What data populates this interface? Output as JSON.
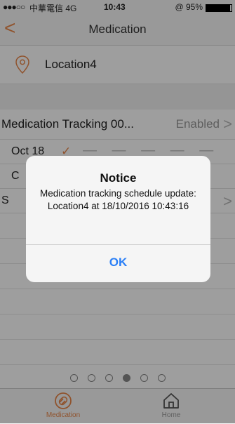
{
  "status_bar": {
    "signal": "●●●○○",
    "carrier": "中華電信 4G",
    "time": "10:43",
    "battery": "@ 95%",
    "battery_level": 0.95
  },
  "nav": {
    "back": "<",
    "title": "Medication"
  },
  "location": {
    "name": "Location4"
  },
  "tracking": {
    "label": "Medication Tracking 00...",
    "status": "Enabled",
    "chevron": ">"
  },
  "schedule": {
    "date": "Oct  18",
    "check": "✓",
    "dashes": "— — — — — —"
  },
  "rows": {
    "row_b_label": "C",
    "row_c_label": "S",
    "row_c_chevron": ">"
  },
  "pager": {
    "count": 6,
    "active_index": 3
  },
  "tabbar": {
    "items": [
      {
        "label": "Medication",
        "icon": "pill-icon",
        "active": true
      },
      {
        "label": "Home",
        "icon": "home-icon",
        "active": false
      }
    ]
  },
  "alert": {
    "title": "Notice",
    "message": "Medication tracking schedule update: Location4 at 18/10/2016 10:43:16",
    "ok_label": "OK"
  },
  "colors": {
    "accent": "#e8874a",
    "ok_button": "#2a7ff6"
  }
}
